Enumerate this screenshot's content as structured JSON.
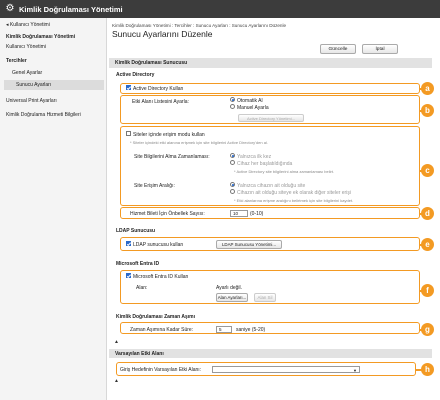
{
  "app": {
    "title": "Kimlik Doğrulaması Yönetimi",
    "icon": "gear-icon"
  },
  "sidebar": {
    "back": "Kullanıcı Yönetimi",
    "section_auth": "Kimlik Doğrulaması Yönetimi",
    "user_mgmt": "Kullanıcı Yönetimi",
    "prefs": "Tercihler",
    "general": "Genel Ayarlar",
    "server": "Sunucu Ayarları",
    "print": "Universal Print Ayarları",
    "service_info": "Kimlik Doğrulama Hizmeti Bilgileri"
  },
  "main": {
    "breadcrumb": "Kimlik Doğrulaması Yönetimi : Tercihler : Sunucu Ayarları : Sunucu Ayarlarını Düzenle",
    "title": "Sunucu Ayarlarını Düzenle",
    "update_btn": "Güncelle",
    "cancel_btn": "İptal"
  },
  "auth_server": {
    "heading": "Kimlik Doğrulaması Sunucusu",
    "ad_heading": "Active Directory",
    "use_ad": "Active Directory Kullan",
    "domain_list_label": "Etki Alanı Listesini Ayarla:",
    "auto": "Otomatik Al",
    "manual": "Manuel Ayarla",
    "domain_list_btn": "Active Directory Yönetimi...",
    "site_access_cb": "Siteler içinde erişim modu kullan",
    "site_access_note": "* Siteler içindeki etki alanına erişmek için site bilgilerini Active Directory'den al.",
    "site_info_label": "Site Bilgilerini Alma Zamanlaması:",
    "first_only": "Yalnızca ilk kez",
    "on_start": "Cihaz her başlatıldığında",
    "site_info_note": "* Active Directory site bilgilerini alma zamanlaması belirt.",
    "range_label": "Site Erişim Aralığı:",
    "range_opt1": "Yalnızca cihazın ait olduğu site",
    "range_opt2": "Cihazın ait olduğu siteye ek olarak diğer siteler erişi",
    "range_note": "* Etki alanlarına erişme aralığını belirtmek için site bilgilerini kaydet.",
    "threads_label": "Hizmet Bileti İçin Önbellek Sayısı:",
    "threads_value": "10",
    "threads_range": "(0-10)"
  },
  "ldap": {
    "heading": "LDAP Sunucusu",
    "use_ldap": "LDAP sunucusu kullan",
    "mgmt_btn": "LDAP Sunucusu Yönetimi..."
  },
  "entra": {
    "heading": "Microsoft Entra ID",
    "use_entra": "Microsoft Entra ID Kullan",
    "domain_label": "Alan:",
    "domain_value": "Ayarlı değil.",
    "settings_btn": "Alan Ayarları...",
    "delete_btn": "Alan Sil"
  },
  "timeout": {
    "heading": "Kimlik Doğrulaması Zaman Aşımı",
    "label": "Zaman Aşımına Kadar Süre:",
    "value": "5",
    "unit": "saniye (5-20)"
  },
  "default_domain": {
    "heading": "Varsayılan Etki Alanı",
    "label": "Giriş Hedefinin Varsayılan Etki Alanı:",
    "value": ""
  },
  "callouts": [
    "a",
    "b",
    "c",
    "d",
    "e",
    "f",
    "g",
    "h"
  ],
  "colors": {
    "titlebar": "#3c3c3c",
    "callout": "#f39a23",
    "accent": "#2a6acb"
  }
}
